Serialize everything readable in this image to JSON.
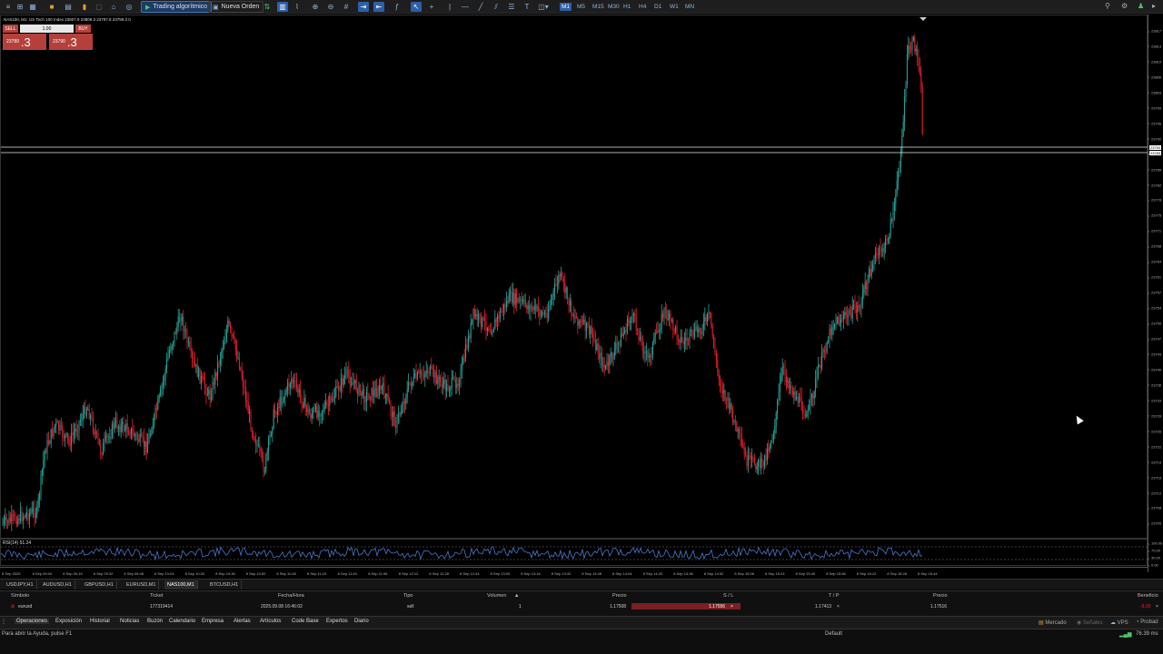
{
  "toolbar": {
    "algo_label": "Trading algorítmico",
    "new_order_label": "Nueva Orden",
    "timeframes": [
      "M1",
      "M5",
      "M15",
      "M30",
      "H1",
      "H4",
      "D1",
      "W1",
      "MN"
    ],
    "active_timeframe": "M1"
  },
  "chart": {
    "title": "NAS100, M1: US Tech 100 Index  23807.9 23809.3 23797.8 23799.3  0",
    "trade_panel": {
      "sell_label": "SELL",
      "buy_label": "BUY",
      "volume": "1.00",
      "sell_price_small": "23789",
      "sell_price_big": ".3",
      "buy_price_small": "23790",
      "buy_price_big": ".3"
    },
    "price_ticks": [
      "23817",
      "23813",
      "23810",
      "23806",
      "23803",
      "23799",
      "23796",
      "23792",
      "23789",
      "23785",
      "23782",
      "23778",
      "23775",
      "23771",
      "23768",
      "23764",
      "23761",
      "23757",
      "23754",
      "23750",
      "23747",
      "23743",
      "23740",
      "23736",
      "23733",
      "23729",
      "23726",
      "23722",
      "23719",
      "23715",
      "23712",
      "23708",
      "23705"
    ],
    "bid_tag": "23789",
    "ask_tag": "23790",
    "time_ticks": [
      "8 Sep 2025",
      "8 Sep 09:00",
      "8 Sep 09:16",
      "8 Sep 09:32",
      "8 Sep 09:48",
      "8 Sep 10:04",
      "8 Sep 10:20",
      "8 Sep 10:36",
      "8 Sep 10:52",
      "8 Sep 11:08",
      "8 Sep 11:24",
      "8 Sep 11:40",
      "8 Sep 11:56",
      "8 Sep 12:12",
      "8 Sep 12:28",
      "8 Sep 12:44",
      "8 Sep 13:00",
      "8 Sep 13:16",
      "8 Sep 13:32",
      "8 Sep 13:48",
      "8 Sep 14:04",
      "8 Sep 14:20",
      "8 Sep 14:36",
      "8 Sep 14:52",
      "8 Sep 15:08",
      "8 Sep 15:24",
      "8 Sep 15:40",
      "8 Sep 15:56",
      "8 Sep 16:12",
      "8 Sep 16:28",
      "8 Sep 16:44"
    ],
    "colors": {
      "up": "#26a69a",
      "down": "#e5202e",
      "rsi": "#4a78c8"
    }
  },
  "rsi": {
    "label": "RSI(14) 51.24",
    "ticks": [
      "100.00",
      "70.00",
      "30.00",
      "0.00"
    ]
  },
  "symbol_tabs": [
    "USDJPY,H1",
    "AUDUSD,H1",
    "GBPUSD,H1",
    "EURUSD,M1",
    "NAS100,M1",
    "BTCUSD,H1"
  ],
  "active_symbol_tab": "NAS100,M1",
  "terminal": {
    "headers": {
      "symbol": "Símbolo",
      "ticket": "Ticket",
      "time": "Fecha/Hora",
      "type": "Tipo",
      "volume": "Volumen",
      "price": "Precio",
      "sl": "S / L",
      "tp": "T / P",
      "price_current": "Precio",
      "profit": "Beneficio"
    },
    "row": {
      "symbol": "eurusd",
      "ticket": "177319414",
      "time": "2025.09.08 16:46:02",
      "type": "sell",
      "volume": "1",
      "price": "1.17508",
      "sl": "1.17556",
      "tp": "1.17413",
      "price_current": "1.17516",
      "profit": "-8.00"
    }
  },
  "term_tabs": [
    "Operaciones",
    "Exposición",
    "Historial",
    "Noticias",
    "Buzón",
    "Calendario",
    "Empresa",
    "Alertas",
    "Artículos",
    "Code Base",
    "Expertos",
    "Diario"
  ],
  "term_right": {
    "market": "Mercado",
    "signals": "Señales",
    "vps": "VPS",
    "tester": "Probad"
  },
  "status": {
    "help": "Para abrir la Ayuda, pulse F1",
    "profile": "Default",
    "ping": "76.39 ms"
  }
}
